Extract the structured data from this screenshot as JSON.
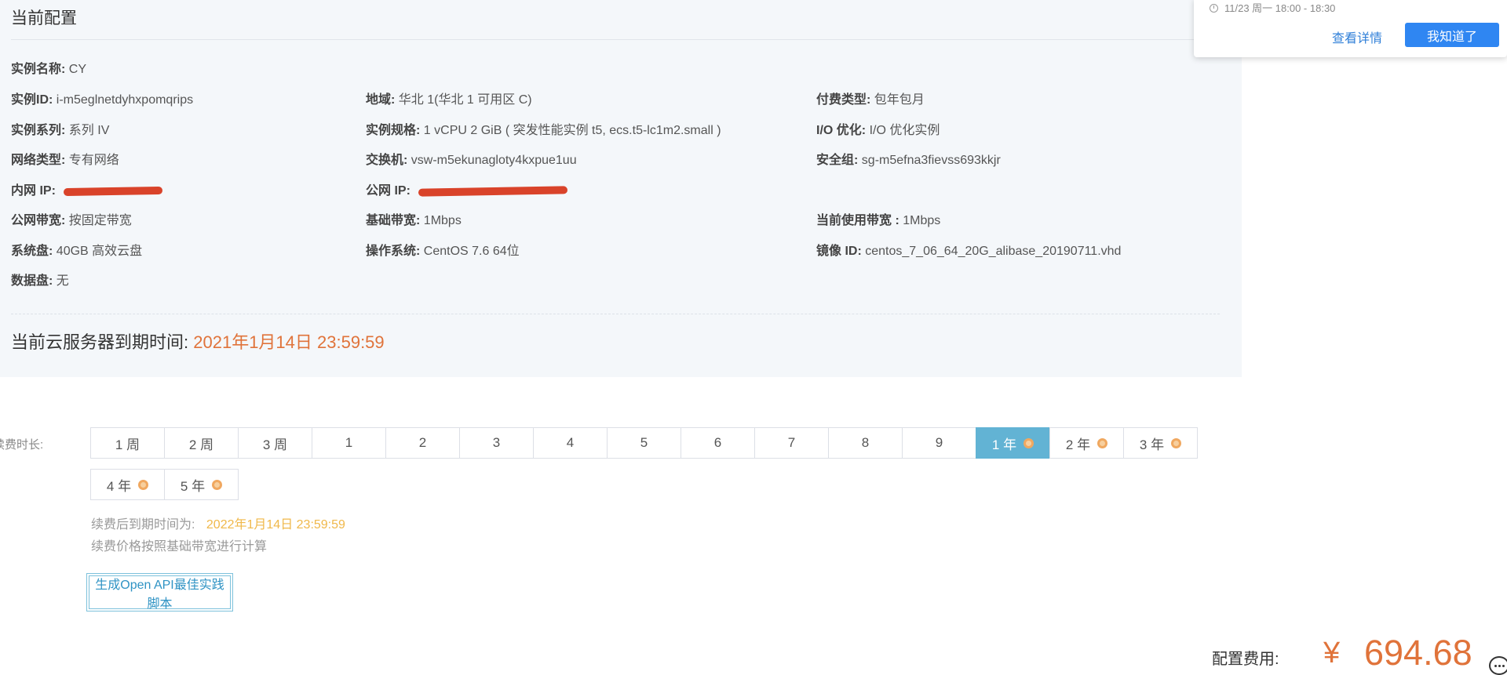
{
  "config": {
    "title": "当前配置",
    "fields": [
      {
        "label": "实例名称:",
        "value": "CY"
      },
      {
        "label": "实例ID:",
        "value": "i-m5eglnetdyhxpomqrips"
      },
      {
        "label": "地域:",
        "value": "华北 1(华北 1 可用区 C)"
      },
      {
        "label": "付费类型:",
        "value": "包年包月"
      },
      {
        "label": "实例系列:",
        "value": "系列 IV"
      },
      {
        "label": "实例规格:",
        "value": "1 vCPU 2 GiB ( 突发性能实例 t5, ecs.t5-lc1m2.small )"
      },
      {
        "label": "I/O 优化:",
        "value": "I/O 优化实例"
      },
      {
        "label": "网络类型:",
        "value": "专有网络"
      },
      {
        "label": "交换机:",
        "value": "vsw-m5ekunagloty4kxpue1uu"
      },
      {
        "label": "安全组:",
        "value": "sg-m5efna3fievss693kkjr"
      },
      {
        "label": "内网 IP:",
        "value": ""
      },
      {
        "label": "公网 IP:",
        "value": ""
      },
      {
        "label": "公网带宽:",
        "value": "按固定带宽"
      },
      {
        "label": "基础带宽:",
        "value": "1Mbps"
      },
      {
        "label": "当前使用带宽 :",
        "value": "1Mbps"
      },
      {
        "label": "系统盘:",
        "value": "40GB 高效云盘"
      },
      {
        "label": "操作系统:",
        "value": "CentOS 7.6 64位"
      },
      {
        "label": "镜像 ID:",
        "value": "centos_7_06_64_20G_alibase_20190711.vhd"
      },
      {
        "label": "数据盘:",
        "value": "无"
      }
    ],
    "expire_label": "当前云服务器到期时间:",
    "expire_value": "2021年1月14日 23:59:59"
  },
  "renew": {
    "duration_label": "续费时长:",
    "options": [
      {
        "label": "1 周",
        "discount": false
      },
      {
        "label": "2 周",
        "discount": false
      },
      {
        "label": "3 周",
        "discount": false
      },
      {
        "label": "1",
        "discount": false
      },
      {
        "label": "2",
        "discount": false
      },
      {
        "label": "3",
        "discount": false
      },
      {
        "label": "4",
        "discount": false
      },
      {
        "label": "5",
        "discount": false
      },
      {
        "label": "6",
        "discount": false
      },
      {
        "label": "7",
        "discount": false
      },
      {
        "label": "8",
        "discount": false
      },
      {
        "label": "9",
        "discount": false
      },
      {
        "label": "1 年",
        "discount": true,
        "selected": true
      },
      {
        "label": "2 年",
        "discount": true
      },
      {
        "label": "3 年",
        "discount": true
      },
      {
        "label": "4 年",
        "discount": true
      },
      {
        "label": "5 年",
        "discount": true
      }
    ],
    "new_expire_label": "续费后到期时间为:",
    "new_expire_value": "2022年1月14日 23:59:59",
    "price_note": "续费价格按照基础带宽进行计算",
    "api_button": "生成Open API最佳实践脚本"
  },
  "cost": {
    "label": "配置费用:",
    "currency": "¥",
    "amount": "694.68"
  },
  "notification": {
    "time": "11/23 周一 18:00 - 18:30",
    "details_link": "查看详情",
    "ack_button": "我知道了"
  },
  "colors": {
    "accent_orange": "#e0733a",
    "selected_segment": "#62b3d4",
    "redaction": "#d9432a",
    "primary_blue": "#2f86f2"
  }
}
